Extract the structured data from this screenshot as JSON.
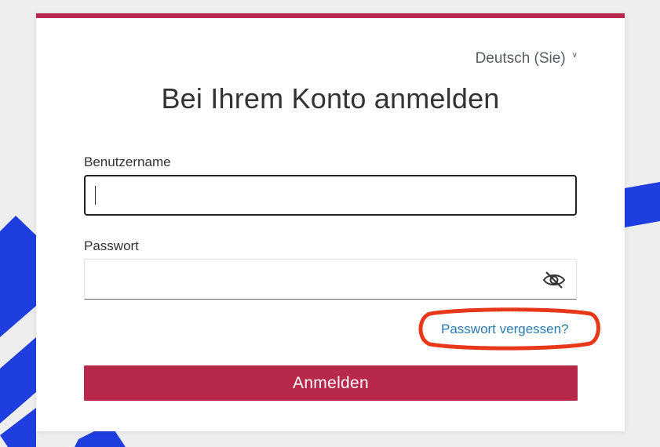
{
  "colors": {
    "accent": "#b8284a",
    "link": "#2a7ab0",
    "highlight": "#e8381a",
    "background_deco": "#1f3ee0"
  },
  "language": {
    "selected": "Deutsch (Sie)",
    "icon": "chevron-down-icon"
  },
  "login": {
    "title": "Bei Ihrem Konto anmelden",
    "username_label": "Benutzername",
    "username_value": "",
    "password_label": "Passwort",
    "password_value": "",
    "password_toggle_icon": "eye-slash-icon",
    "forgot_password": "Passwort vergessen?",
    "submit_label": "Anmelden"
  }
}
